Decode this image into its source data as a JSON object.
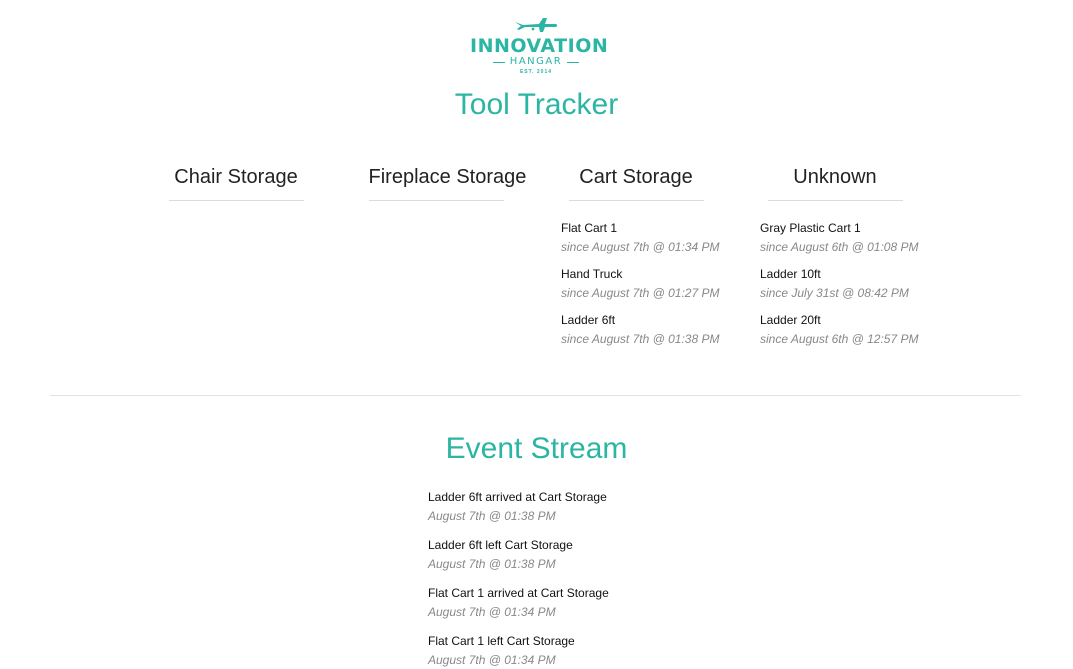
{
  "logo": {
    "name": "INNOVATION",
    "sub": "HANGAR",
    "est": "EST. 2014"
  },
  "title": "Tool Tracker",
  "columns": [
    {
      "heading": "Chair Storage",
      "tools": []
    },
    {
      "heading": "Fireplace Storage",
      "tools": []
    },
    {
      "heading": "Cart Storage",
      "tools": [
        {
          "name": "Flat Cart 1",
          "since": "since August 7th @ 01:34 PM"
        },
        {
          "name": "Hand Truck",
          "since": "since August 7th @ 01:27 PM"
        },
        {
          "name": "Ladder 6ft",
          "since": "since August 7th @ 01:38 PM"
        }
      ]
    },
    {
      "heading": "Unknown",
      "tools": [
        {
          "name": "Gray Plastic Cart 1",
          "since": "since August 6th @ 01:08 PM"
        },
        {
          "name": "Ladder 10ft",
          "since": "since July 31st @ 08:42 PM"
        },
        {
          "name": "Ladder 20ft",
          "since": "since August 6th @ 12:57 PM"
        }
      ]
    }
  ],
  "event_stream": {
    "title": "Event Stream",
    "events": [
      {
        "text": "Ladder 6ft arrived at Cart Storage",
        "time": "August 7th @ 01:38 PM"
      },
      {
        "text": "Ladder 6ft left Cart Storage",
        "time": "August 7th @ 01:38 PM"
      },
      {
        "text": "Flat Cart 1 arrived at Cart Storage",
        "time": "August 7th @ 01:34 PM"
      },
      {
        "text": "Flat Cart 1 left Cart Storage",
        "time": "August 7th @ 01:34 PM"
      }
    ]
  },
  "colors": {
    "accent": "#2bb5a3"
  }
}
